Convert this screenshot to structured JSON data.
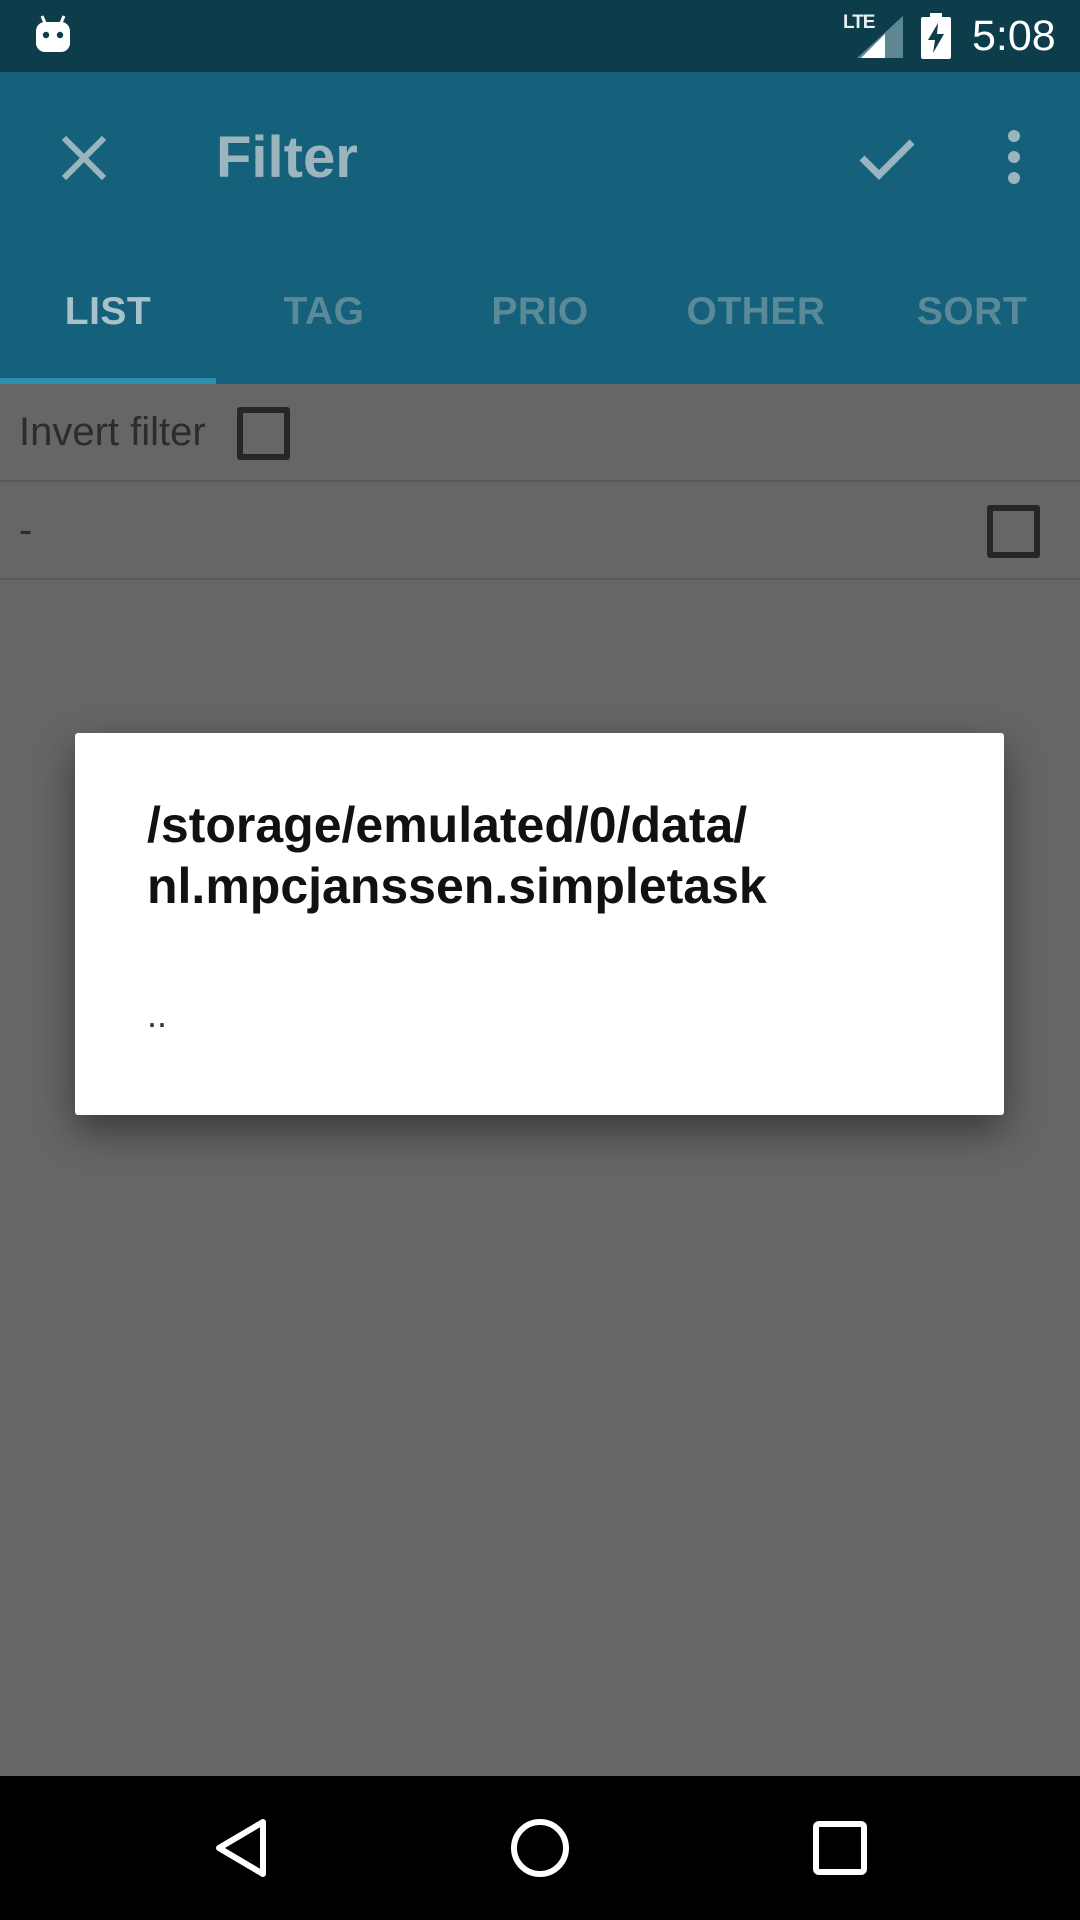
{
  "status_bar": {
    "time": "5:08",
    "network": "LTE",
    "icons": [
      "android-robot-icon",
      "lte-signal-icon",
      "battery-charging-icon"
    ]
  },
  "app_bar": {
    "title": "Filter",
    "close_icon": "close-icon",
    "confirm_icon": "check-icon",
    "menu_icon": "more-vert-icon",
    "background": "#15607a"
  },
  "tabs": [
    {
      "label": "LIST",
      "active": true
    },
    {
      "label": "TAG",
      "active": false
    },
    {
      "label": "PRIO",
      "active": false
    },
    {
      "label": "OTHER",
      "active": false
    },
    {
      "label": "SORT",
      "active": false
    }
  ],
  "content": {
    "invert_filter_label": "Invert filter",
    "invert_filter_checked": false,
    "list_items": [
      {
        "label": "-",
        "checked": false
      }
    ]
  },
  "dialog": {
    "title_lines": [
      "/storage/emulated/0/data/",
      "nl.mpcjanssen.simpletask"
    ],
    "items": [
      ".."
    ]
  },
  "nav_bar": {
    "icons": [
      "back-icon",
      "home-icon",
      "recents-icon"
    ]
  }
}
